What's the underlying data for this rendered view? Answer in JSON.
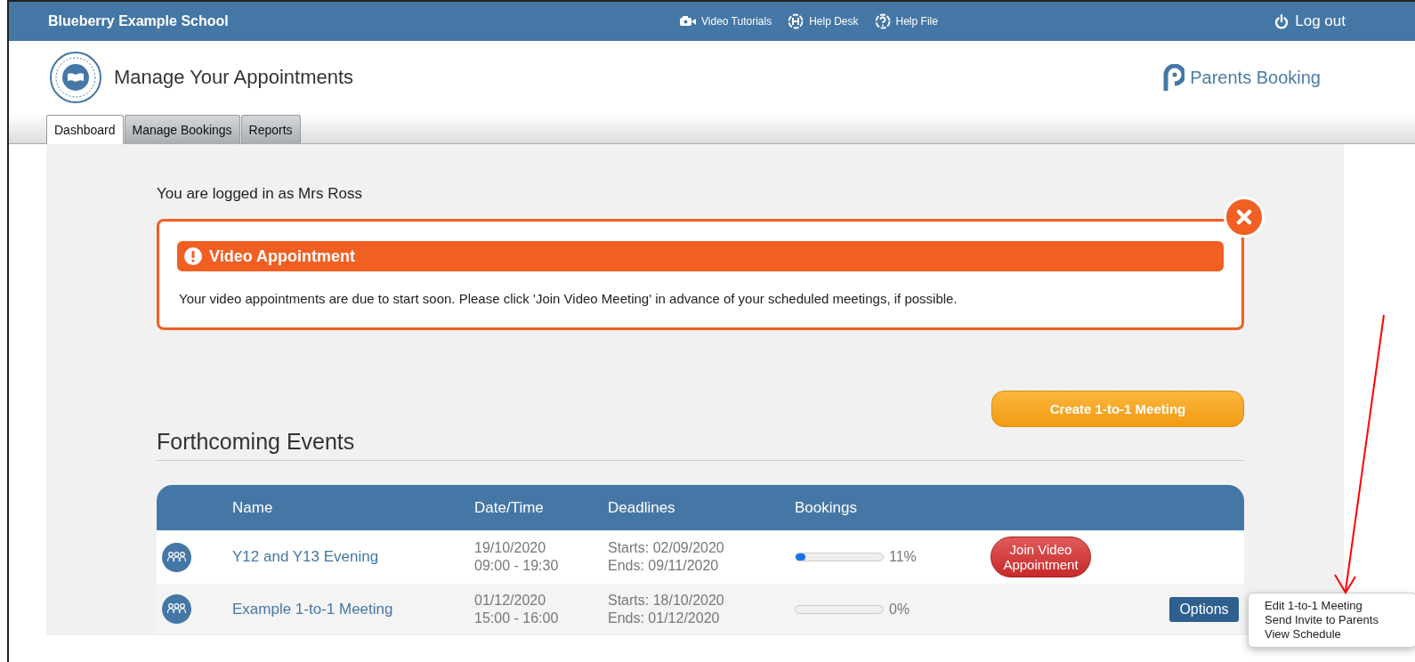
{
  "topbar": {
    "school": "Blueberry Example School",
    "links": [
      {
        "kind": "video",
        "label": "Video Tutorials"
      },
      {
        "kind": "helpdesk",
        "label": "Help Desk"
      },
      {
        "kind": "helpfile",
        "label": "Help File"
      }
    ],
    "logout": "Log out"
  },
  "header": {
    "title": "Manage Your Appointments",
    "brand": "Parents Booking"
  },
  "tabs": [
    {
      "label": "Dashboard",
      "selected": true
    },
    {
      "label": "Manage Bookings",
      "selected": false
    },
    {
      "label": "Reports",
      "selected": false
    }
  ],
  "logged_in": "You are logged in as Mrs Ross",
  "alert": {
    "title": "Video Appointment",
    "message": "Your video appointments are due to start soon. Please click 'Join Video Meeting' in advance of your scheduled meetings, if possible."
  },
  "create_button": "Create 1-to-1 Meeting",
  "events": {
    "heading": "Forthcoming Events",
    "columns": [
      "Name",
      "Date/Time",
      "Deadlines",
      "Bookings"
    ],
    "rows": [
      {
        "name": "Y12 and Y13 Evening",
        "date": "19/10/2020",
        "time": "09:00 - 19:30",
        "starts": "Starts: 02/09/2020",
        "ends": "Ends: 09/11/2020",
        "level": 0.11,
        "percent": "11%",
        "action": {
          "kind": "video",
          "label": "Join Video Appointment"
        }
      },
      {
        "name": "Example 1-to-1 Meeting",
        "date": "01/12/2020",
        "time": "15:00 - 16:00",
        "starts": "Starts: 18/10/2020",
        "ends": "Ends: 01/12/2020",
        "percent": "0%",
        "action": {
          "kind": "options",
          "label": "Options",
          "expanded": true,
          "menu": [
            "Edit 1-to-1 Meeting",
            "Send Invite to Parents",
            "View Schedule"
          ]
        }
      }
    ]
  }
}
